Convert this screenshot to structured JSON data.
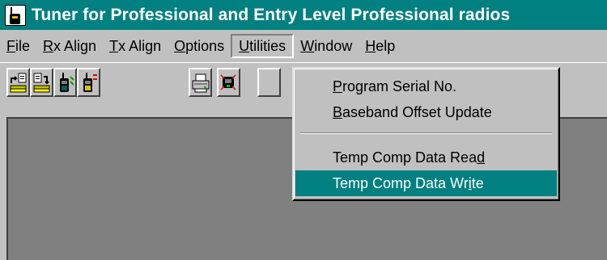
{
  "window": {
    "title": "Tuner for Professional and Entry Level Professional radios",
    "app_icon": "radio-icon"
  },
  "menubar": {
    "items": [
      {
        "pre": "",
        "ul": "F",
        "post": "ile"
      },
      {
        "pre": "",
        "ul": "R",
        "post": "x Align"
      },
      {
        "pre": "",
        "ul": "T",
        "post": "x Align"
      },
      {
        "pre": "",
        "ul": "O",
        "post": "ptions"
      },
      {
        "pre": "",
        "ul": "U",
        "post": "tilities"
      },
      {
        "pre": "",
        "ul": "W",
        "post": "indow"
      },
      {
        "pre": "",
        "ul": "H",
        "post": "elp"
      }
    ],
    "open_menu": "Utilities"
  },
  "toolbar": {
    "buttons": [
      {
        "icon": "folder-open-icon"
      },
      {
        "icon": "folder-save-icon"
      },
      {
        "icon": "radio-receive-icon"
      },
      {
        "icon": "radio-transmit-icon"
      },
      {
        "icon": "printer-icon"
      },
      {
        "icon": "radio-connect-icon"
      }
    ]
  },
  "utilities_menu": {
    "items": [
      {
        "pre": "",
        "ul": "P",
        "post": "rogram Serial No."
      },
      {
        "pre": "",
        "ul": "B",
        "post": "aseband Offset Update"
      },
      {
        "pre": "Temp Comp Data Rea",
        "ul": "d",
        "post": ""
      },
      {
        "pre": "Temp Comp Data Wr",
        "ul": "i",
        "post": "te"
      }
    ],
    "selected_index": 3
  },
  "colors": {
    "titlebar": "#008080",
    "face": "#c0c0c0",
    "workspace": "#808080",
    "highlight": "#008080"
  }
}
